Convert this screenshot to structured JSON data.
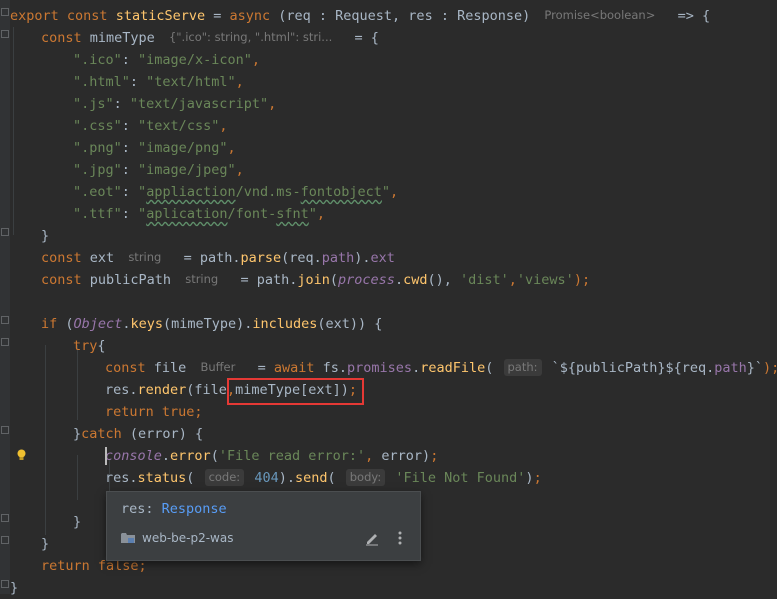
{
  "lines": [
    {
      "id": "l1",
      "tokens": [
        {
          "t": "export ",
          "c": "kw"
        },
        {
          "t": "const ",
          "c": "kw"
        },
        {
          "t": "staticServe",
          "c": "fn"
        },
        {
          "t": " = ",
          "c": "plain"
        },
        {
          "t": "async ",
          "c": "kw"
        },
        {
          "t": "(req : Request, res : Response)",
          "c": "plain"
        },
        {
          "t": " ",
          "c": "plain"
        },
        {
          "t": "Promise<boolean>",
          "c": "hint bare"
        },
        {
          "t": "  => {",
          "c": "plain"
        }
      ]
    },
    {
      "id": "l2",
      "tokens": [
        {
          "t": "const ",
          "c": "kw"
        },
        {
          "t": "mimeType",
          "c": "plain"
        },
        {
          "t": " ",
          "c": "plain"
        },
        {
          "t": "{\".ico\": string, \".html\": stri...",
          "c": "hint bare"
        },
        {
          "t": "  = {",
          "c": "plain"
        }
      ]
    },
    {
      "id": "l3",
      "tokens": [
        {
          "t": "\".ico\"",
          "c": "str"
        },
        {
          "t": ": ",
          "c": "plain"
        },
        {
          "t": "\"image/x-icon\"",
          "c": "str"
        },
        {
          "t": ",",
          "c": "kw"
        }
      ]
    },
    {
      "id": "l4",
      "tokens": [
        {
          "t": "\".html\"",
          "c": "str"
        },
        {
          "t": ": ",
          "c": "plain"
        },
        {
          "t": "\"text/html\"",
          "c": "str"
        },
        {
          "t": ",",
          "c": "kw"
        }
      ]
    },
    {
      "id": "l5",
      "tokens": [
        {
          "t": "\".js\"",
          "c": "str"
        },
        {
          "t": ": ",
          "c": "plain"
        },
        {
          "t": "\"text/javascript\"",
          "c": "str"
        },
        {
          "t": ",",
          "c": "kw"
        }
      ]
    },
    {
      "id": "l6",
      "tokens": [
        {
          "t": "\".css\"",
          "c": "str"
        },
        {
          "t": ": ",
          "c": "plain"
        },
        {
          "t": "\"text/css\"",
          "c": "str"
        },
        {
          "t": ",",
          "c": "kw"
        }
      ]
    },
    {
      "id": "l7",
      "tokens": [
        {
          "t": "\".png\"",
          "c": "str"
        },
        {
          "t": ": ",
          "c": "plain"
        },
        {
          "t": "\"image/png\"",
          "c": "str"
        },
        {
          "t": ",",
          "c": "kw"
        }
      ]
    },
    {
      "id": "l8",
      "tokens": [
        {
          "t": "\".jpg\"",
          "c": "str"
        },
        {
          "t": ": ",
          "c": "plain"
        },
        {
          "t": "\"image/jpeg\"",
          "c": "str"
        },
        {
          "t": ",",
          "c": "kw"
        }
      ]
    },
    {
      "id": "l9",
      "tokens": [
        {
          "t": "\".eot\"",
          "c": "str"
        },
        {
          "t": ": ",
          "c": "plain"
        },
        {
          "t": "\"",
          "c": "str"
        },
        {
          "t": "appliaction",
          "c": "str typo"
        },
        {
          "t": "/vnd.ms-",
          "c": "str"
        },
        {
          "t": "fontobject",
          "c": "str typo"
        },
        {
          "t": "\"",
          "c": "str"
        },
        {
          "t": ",",
          "c": "kw"
        }
      ]
    },
    {
      "id": "l10",
      "tokens": [
        {
          "t": "\".ttf\"",
          "c": "str"
        },
        {
          "t": ": ",
          "c": "plain"
        },
        {
          "t": "\"",
          "c": "str"
        },
        {
          "t": "aplication",
          "c": "str typo"
        },
        {
          "t": "/font-",
          "c": "str"
        },
        {
          "t": "sfnt",
          "c": "str typo"
        },
        {
          "t": "\"",
          "c": "str"
        },
        {
          "t": ",",
          "c": "kw"
        }
      ]
    },
    {
      "id": "l11",
      "tokens": [
        {
          "t": "}",
          "c": "plain"
        }
      ]
    },
    {
      "id": "l12",
      "tokens": [
        {
          "t": "const ",
          "c": "kw"
        },
        {
          "t": "ext",
          "c": "plain"
        },
        {
          "t": " ",
          "c": "plain"
        },
        {
          "t": "string",
          "c": "hint bare"
        },
        {
          "t": "  = path.",
          "c": "plain"
        },
        {
          "t": "parse",
          "c": "fn"
        },
        {
          "t": "(req.",
          "c": "plain"
        },
        {
          "t": "path",
          "c": "fld"
        },
        {
          "t": ").",
          "c": "plain"
        },
        {
          "t": "ext",
          "c": "fld"
        }
      ]
    },
    {
      "id": "l13",
      "tokens": [
        {
          "t": "const ",
          "c": "kw"
        },
        {
          "t": "publicPath",
          "c": "plain"
        },
        {
          "t": " ",
          "c": "plain"
        },
        {
          "t": "string",
          "c": "hint bare"
        },
        {
          "t": "  = path.",
          "c": "plain"
        },
        {
          "t": "join",
          "c": "fn"
        },
        {
          "t": "(",
          "c": "plain"
        },
        {
          "t": "process",
          "c": "glob"
        },
        {
          "t": ".",
          "c": "plain"
        },
        {
          "t": "cwd",
          "c": "fn"
        },
        {
          "t": "(), ",
          "c": "plain"
        },
        {
          "t": "'dist'",
          "c": "str"
        },
        {
          "t": ",",
          "c": "kw"
        },
        {
          "t": "'views'",
          "c": "str"
        },
        {
          "t": ");",
          "c": "kw"
        }
      ]
    },
    {
      "id": "l14",
      "tokens": []
    },
    {
      "id": "l15",
      "tokens": [
        {
          "t": "if ",
          "c": "kw"
        },
        {
          "t": "(",
          "c": "plain"
        },
        {
          "t": "Object",
          "c": "glob"
        },
        {
          "t": ".",
          "c": "plain"
        },
        {
          "t": "keys",
          "c": "fn"
        },
        {
          "t": "(mimeType).",
          "c": "plain"
        },
        {
          "t": "includes",
          "c": "fn"
        },
        {
          "t": "(ext)) {",
          "c": "plain"
        }
      ]
    },
    {
      "id": "l16",
      "tokens": [
        {
          "t": "try",
          "c": "kw"
        },
        {
          "t": "{",
          "c": "plain"
        }
      ]
    },
    {
      "id": "l17",
      "tokens": [
        {
          "t": "const ",
          "c": "kw"
        },
        {
          "t": "file",
          "c": "plain"
        },
        {
          "t": " ",
          "c": "plain"
        },
        {
          "t": "Buffer",
          "c": "hint bare"
        },
        {
          "t": "  = ",
          "c": "plain"
        },
        {
          "t": "await ",
          "c": "kw"
        },
        {
          "t": "fs.",
          "c": "plain"
        },
        {
          "t": "promises",
          "c": "fld"
        },
        {
          "t": ".",
          "c": "plain"
        },
        {
          "t": "readFile",
          "c": "fn"
        },
        {
          "t": "( ",
          "c": "plain"
        },
        {
          "t": "path:",
          "c": "hint"
        },
        {
          "t": " ",
          "c": "plain"
        },
        {
          "t": "`${publicPath}${req.",
          "c": "plain"
        },
        {
          "t": "path",
          "c": "fld"
        },
        {
          "t": "}`",
          "c": "plain"
        },
        {
          "t": ");",
          "c": "kw"
        }
      ]
    },
    {
      "id": "l18",
      "tokens": [
        {
          "t": "res.",
          "c": "plain"
        },
        {
          "t": "render",
          "c": "fn"
        },
        {
          "t": "(file",
          "c": "plain"
        },
        {
          "t": ",",
          "c": "kw"
        },
        {
          "t": "mimeType[ext])",
          "c": "plain"
        },
        {
          "t": ";",
          "c": "kw"
        }
      ]
    },
    {
      "id": "l19",
      "tokens": [
        {
          "t": "return ",
          "c": "kw"
        },
        {
          "t": "true",
          "c": "kw"
        },
        {
          "t": ";",
          "c": "kw"
        }
      ]
    },
    {
      "id": "l20",
      "tokens": [
        {
          "t": "}",
          "c": "plain"
        },
        {
          "t": "catch ",
          "c": "kw"
        },
        {
          "t": "(error) {",
          "c": "plain"
        }
      ]
    },
    {
      "id": "l21",
      "tokens": [
        {
          "t": "console",
          "c": "glob"
        },
        {
          "t": ".",
          "c": "plain"
        },
        {
          "t": "error",
          "c": "fn"
        },
        {
          "t": "(",
          "c": "plain"
        },
        {
          "t": "'File read error:'",
          "c": "str"
        },
        {
          "t": ", ",
          "c": "kw"
        },
        {
          "t": "error)",
          "c": "plain"
        },
        {
          "t": ";",
          "c": "kw"
        }
      ]
    },
    {
      "id": "l22",
      "tokens": [
        {
          "t": "res.",
          "c": "plain"
        },
        {
          "t": "status",
          "c": "fn"
        },
        {
          "t": "( ",
          "c": "plain"
        },
        {
          "t": "code:",
          "c": "hint"
        },
        {
          "t": " ",
          "c": "plain"
        },
        {
          "t": "404",
          "c": "num"
        },
        {
          "t": ").",
          "c": "plain"
        },
        {
          "t": "send",
          "c": "fn"
        },
        {
          "t": "( ",
          "c": "plain"
        },
        {
          "t": "body:",
          "c": "hint"
        },
        {
          "t": " ",
          "c": "plain"
        },
        {
          "t": "'File Not Found'",
          "c": "str"
        },
        {
          "t": ")",
          "c": "plain"
        },
        {
          "t": ";",
          "c": "kw"
        }
      ]
    },
    {
      "id": "l23",
      "tokens": []
    },
    {
      "id": "l24",
      "tokens": [
        {
          "t": "}",
          "c": "plain"
        }
      ]
    },
    {
      "id": "l25",
      "tokens": [
        {
          "t": "}",
          "c": "plain"
        }
      ]
    },
    {
      "id": "l26",
      "tokens": [
        {
          "t": "return ",
          "c": "kw"
        },
        {
          "t": "false",
          "c": "kw"
        },
        {
          "t": ";",
          "c": "kw"
        }
      ]
    },
    {
      "id": "l27",
      "tokens": [
        {
          "t": "}",
          "c": "plain"
        }
      ]
    }
  ],
  "popup": {
    "var_name": "res",
    "separator": ": ",
    "type_name": "Response",
    "source_module": "web-be-p2-was",
    "edit_icon": "pencil-icon",
    "more_icon": "more-vertical-icon",
    "module_icon": "folder-icon"
  },
  "colors": {
    "background": "#2b2b2b",
    "keyword": "#cc7832",
    "function": "#ffc66d",
    "string": "#6a8759",
    "number": "#6897bb",
    "field": "#9876aa",
    "highlight_box": "#e53935"
  }
}
